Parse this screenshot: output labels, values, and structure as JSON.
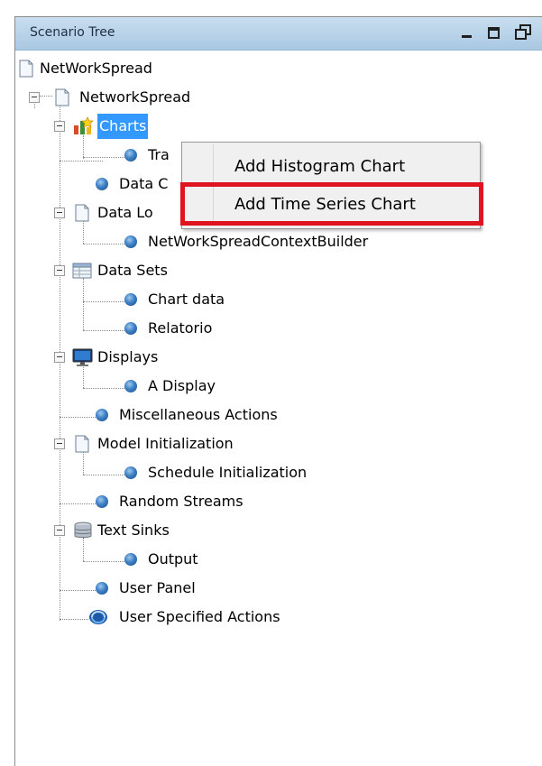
{
  "panel": {
    "title": "Scenario Tree"
  },
  "tree": {
    "root": "NetWorkSpread",
    "child": "NetworkSpread",
    "items": [
      "Charts",
      "Tra",
      "Data C",
      "Data Lo",
      "NetWorkSpreadContextBuilder",
      "Data Sets",
      "Chart data",
      "Relatorio",
      "Displays",
      "A Display",
      "Miscellaneous Actions",
      "Model Initialization",
      "Schedule Initialization",
      "Random Streams",
      "Text Sinks",
      "Output",
      "User Panel",
      "User Specified Actions"
    ]
  },
  "context_menu": {
    "items": [
      "Add Histogram Chart",
      "Add Time Series Chart"
    ]
  },
  "colors": {
    "selection": "#3399ff",
    "highlight_border": "#e0141e",
    "titlebar": "#aac8e2"
  }
}
